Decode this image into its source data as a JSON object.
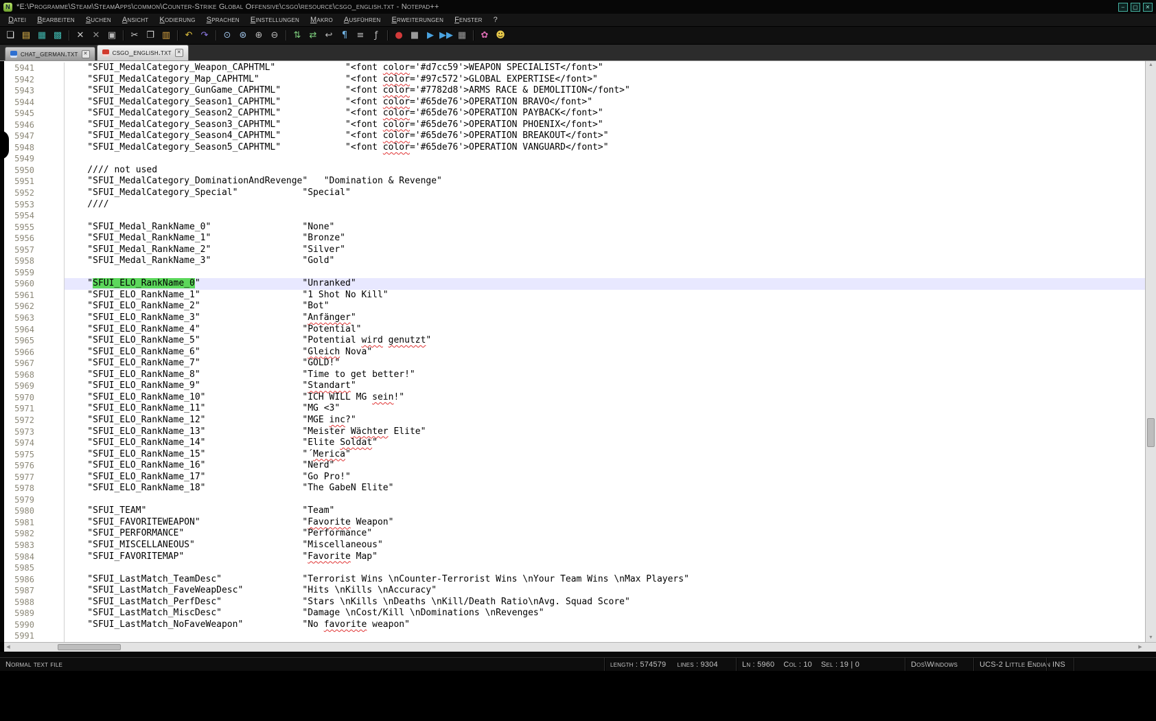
{
  "window": {
    "title": "*E:\\Programme\\Steam\\SteamApps\\common\\Counter-Strike Global Offensive\\csgo\\resource\\csgo_english.txt - Notepad++",
    "app_icon_label": "N",
    "controls": [
      {
        "name": "minimize-button",
        "glyph": "–"
      },
      {
        "name": "maximize-button",
        "glyph": "▢"
      },
      {
        "name": "close-button",
        "glyph": "✕"
      }
    ]
  },
  "menu": {
    "items": [
      {
        "name": "menu-datei",
        "label": "Datei"
      },
      {
        "name": "menu-bearbeiten",
        "label": "Bearbeiten"
      },
      {
        "name": "menu-suchen",
        "label": "Suchen"
      },
      {
        "name": "menu-ansicht",
        "label": "Ansicht"
      },
      {
        "name": "menu-kodierung",
        "label": "Kodierung"
      },
      {
        "name": "menu-sprachen",
        "label": "Sprachen"
      },
      {
        "name": "menu-einstellungen",
        "label": "Einstellungen"
      },
      {
        "name": "menu-makro",
        "label": "Makro"
      },
      {
        "name": "menu-ausfuehren",
        "label": "Ausführen"
      },
      {
        "name": "menu-erweiterungen",
        "label": "Erweiterungen"
      },
      {
        "name": "menu-fenster",
        "label": "Fenster"
      },
      {
        "name": "menu-help",
        "label": "?"
      }
    ]
  },
  "toolbar": {
    "icons": [
      {
        "name": "new-file-icon",
        "glyph": "❏",
        "color": "#e8e8e8"
      },
      {
        "name": "open-file-icon",
        "glyph": "▤",
        "color": "#e3b84d"
      },
      {
        "name": "save-icon",
        "glyph": "▦",
        "color": "#3fb6ad"
      },
      {
        "name": "save-all-icon",
        "glyph": "▩",
        "color": "#3fb6ad"
      },
      {
        "separator": true
      },
      {
        "name": "close-file-icon",
        "glyph": "✕",
        "color": "#c9c9c9"
      },
      {
        "name": "close-all-icon",
        "glyph": "✕",
        "color": "#8f8f8f"
      },
      {
        "name": "print-icon",
        "glyph": "▣",
        "color": "#b9b9b9"
      },
      {
        "separator": true
      },
      {
        "name": "cut-icon",
        "glyph": "✂",
        "color": "#cfcfcf"
      },
      {
        "name": "copy-icon",
        "glyph": "❐",
        "color": "#cfcfcf"
      },
      {
        "name": "paste-icon",
        "glyph": "▥",
        "color": "#d9a441"
      },
      {
        "separator": true
      },
      {
        "name": "undo-icon",
        "glyph": "↶",
        "color": "#e0c23e"
      },
      {
        "name": "redo-icon",
        "glyph": "↷",
        "color": "#8f7be8"
      },
      {
        "separator": true
      },
      {
        "name": "find-icon",
        "glyph": "⊙",
        "color": "#9fc3e8"
      },
      {
        "name": "replace-icon",
        "glyph": "⊛",
        "color": "#9fc3e8"
      },
      {
        "name": "zoom-in-icon",
        "glyph": "⊕",
        "color": "#bcbcbc"
      },
      {
        "name": "zoom-out-icon",
        "glyph": "⊖",
        "color": "#bcbcbc"
      },
      {
        "separator": true
      },
      {
        "name": "sync-vertical-scroll-icon",
        "glyph": "⇅",
        "color": "#7fd17f"
      },
      {
        "name": "sync-horizontal-scroll-icon",
        "glyph": "⇄",
        "color": "#7fd17f"
      },
      {
        "name": "word-wrap-icon",
        "glyph": "↩",
        "color": "#bcbcbc"
      },
      {
        "name": "show-all-characters-icon",
        "glyph": "¶",
        "color": "#74b6e8"
      },
      {
        "name": "indent-guide-icon",
        "glyph": "≡",
        "color": "#bcbcbc"
      },
      {
        "name": "function-list-icon",
        "glyph": "ƒ",
        "color": "#bcbcbc"
      },
      {
        "separator": true
      },
      {
        "name": "record-macro-icon",
        "glyph": "●",
        "color": "#d23a3a"
      },
      {
        "name": "stop-macro-icon",
        "glyph": "■",
        "color": "#9a9a9a"
      },
      {
        "name": "play-macro-icon",
        "glyph": "▶",
        "color": "#4aa3e0"
      },
      {
        "name": "run-macro-multiple-icon",
        "glyph": "▶▶",
        "color": "#4aa3e0"
      },
      {
        "name": "save-macro-icon",
        "glyph": "▦",
        "color": "#9a9a9a"
      },
      {
        "separator": true
      },
      {
        "name": "plugin-icon-1",
        "glyph": "✿",
        "color": "#d86ab0"
      },
      {
        "name": "plugin-icon-2",
        "glyph": "☻",
        "color": "#e8c94a"
      }
    ]
  },
  "tabs": [
    {
      "label": "chat_german.txt",
      "state": "saved",
      "active": false
    },
    {
      "label": "csgo_english.txt",
      "state": "modified",
      "active": true
    }
  ],
  "editor": {
    "colors": {
      "current_line_bg": "#e8e8ff",
      "selection_bg": "#5bd75b",
      "misspell_underline": "#e03131"
    },
    "lines": [
      {
        "n": 5941,
        "k": "\"SFUI_MedalCategory_Weapon_CAPHTML\"",
        "v": "\"<font color='#d7cc59'>WEAPON SPECIALIST</font>\"",
        "c": 52,
        "mis": [
          "color"
        ]
      },
      {
        "n": 5942,
        "k": "\"SFUI_MedalCategory_Map_CAPHTML\"",
        "v": "\"<font color='#97c572'>GLOBAL EXPERTISE</font>\"",
        "c": 52,
        "mis": [
          "color"
        ]
      },
      {
        "n": 5943,
        "k": "\"SFUI_MedalCategory_GunGame_CAPHTML\"",
        "v": "\"<font color='#7782d8'>ARMS RACE & DEMOLITION</font>\"",
        "c": 52,
        "mis": [
          "color"
        ]
      },
      {
        "n": 5944,
        "k": "\"SFUI_MedalCategory_Season1_CAPHTML\"",
        "v": "\"<font color='#65de76'>OPERATION BRAVO</font>\"",
        "c": 52,
        "mis": [
          "color"
        ]
      },
      {
        "n": 5945,
        "k": "\"SFUI_MedalCategory_Season2_CAPHTML\"",
        "v": "\"<font color='#65de76'>OPERATION PAYBACK</font>\"",
        "c": 52,
        "mis": [
          "color"
        ]
      },
      {
        "n": 5946,
        "k": "\"SFUI_MedalCategory_Season3_CAPHTML\"",
        "v": "\"<font color='#65de76'>OPERATION PHOENIX</font>\"",
        "c": 52,
        "mis": [
          "color"
        ]
      },
      {
        "n": 5947,
        "k": "\"SFUI_MedalCategory_Season4_CAPHTML\"",
        "v": "\"<font color='#65de76'>OPERATION BREAKOUT</font>\"",
        "c": 52,
        "mis": [
          "color"
        ]
      },
      {
        "n": 5948,
        "k": "\"SFUI_MedalCategory_Season5_CAPHTML\"",
        "v": "\"<font color='#65de76'>OPERATION VANGUARD</font>\"",
        "c": 52,
        "mis": [
          "color"
        ]
      },
      {
        "n": 5949
      },
      {
        "n": 5950,
        "k": "//// not used"
      },
      {
        "n": 5951,
        "k": "\"SFUI_MedalCategory_DominationAndRevenge\"",
        "v": "\"Domination & Revenge\"",
        "c": 48
      },
      {
        "n": 5952,
        "k": "\"SFUI_MedalCategory_Special\"",
        "v": "\"Special\"",
        "c": 44
      },
      {
        "n": 5953,
        "k": "////"
      },
      {
        "n": 5954
      },
      {
        "n": 5955,
        "k": "\"SFUI_Medal_RankName_0\"",
        "v": "\"None\"",
        "c": 44
      },
      {
        "n": 5956,
        "k": "\"SFUI_Medal_RankName_1\"",
        "v": "\"Bronze\"",
        "c": 44
      },
      {
        "n": 5957,
        "k": "\"SFUI_Medal_RankName_2\"",
        "v": "\"Silver\"",
        "c": 44
      },
      {
        "n": 5958,
        "k": "\"SFUI_Medal_RankName_3\"",
        "v": "\"Gold\"",
        "c": 44
      },
      {
        "n": 5959
      },
      {
        "n": 5960,
        "k": "\"SFUI_ELO_RankName_0\"",
        "v": "\"Unranked\"",
        "c": 44,
        "cur": true,
        "sel": "SFUI_ELO_RankName_0"
      },
      {
        "n": 5961,
        "k": "\"SFUI_ELO_RankName_1\"",
        "v": "\"1 Shot No Kill\"",
        "c": 44
      },
      {
        "n": 5962,
        "k": "\"SFUI_ELO_RankName_2\"",
        "v": "\"Bot\"",
        "c": 44
      },
      {
        "n": 5963,
        "k": "\"SFUI_ELO_RankName_3\"",
        "v": "\"Anfänger\"",
        "c": 44,
        "mis": [
          "Anfänger"
        ]
      },
      {
        "n": 5964,
        "k": "\"SFUI_ELO_RankName_4\"",
        "v": "\"Potential\"",
        "c": 44
      },
      {
        "n": 5965,
        "k": "\"SFUI_ELO_RankName_5\"",
        "v": "\"Potential wird genutzt\"",
        "c": 44,
        "mis": [
          "wird",
          "genutzt"
        ]
      },
      {
        "n": 5966,
        "k": "\"SFUI_ELO_RankName_6\"",
        "v": "\"Gleich Nova\"",
        "c": 44,
        "mis": [
          "Gleich"
        ]
      },
      {
        "n": 5967,
        "k": "\"SFUI_ELO_RankName_7\"",
        "v": "\"GOLD!\"",
        "c": 44
      },
      {
        "n": 5968,
        "k": "\"SFUI_ELO_RankName_8\"",
        "v": "\"Time to get better!\"",
        "c": 44
      },
      {
        "n": 5969,
        "k": "\"SFUI_ELO_RankName_9\"",
        "v": "\"Standart\"",
        "c": 44,
        "mis": [
          "Standart"
        ]
      },
      {
        "n": 5970,
        "k": "\"SFUI_ELO_RankName_10\"",
        "v": "\"ICH WILL MG sein!\"",
        "c": 44,
        "mis": [
          "sein"
        ]
      },
      {
        "n": 5971,
        "k": "\"SFUI_ELO_RankName_11\"",
        "v": "\"MG <3\"",
        "c": 44
      },
      {
        "n": 5972,
        "k": "\"SFUI_ELO_RankName_12\"",
        "v": "\"MGE inc?\"",
        "c": 44,
        "mis": [
          "inc"
        ]
      },
      {
        "n": 5973,
        "k": "\"SFUI_ELO_RankName_13\"",
        "v": "\"Meister Wächter Elite\"",
        "c": 44,
        "mis": [
          "Wächter"
        ]
      },
      {
        "n": 5974,
        "k": "\"SFUI_ELO_RankName_14\"",
        "v": "\"Elite Soldat\"",
        "c": 44,
        "mis": [
          "Soldat"
        ]
      },
      {
        "n": 5975,
        "k": "\"SFUI_ELO_RankName_15\"",
        "v": "\"´Merica\"",
        "c": 44,
        "mis": [
          "Merica"
        ]
      },
      {
        "n": 5976,
        "k": "\"SFUI_ELO_RankName_16\"",
        "v": "\"Nerd\"",
        "c": 44
      },
      {
        "n": 5977,
        "k": "\"SFUI_ELO_RankName_17\"",
        "v": "\"Go Pro!\"",
        "c": 44
      },
      {
        "n": 5978,
        "k": "\"SFUI_ELO_RankName_18\"",
        "v": "\"The GabeN Elite\"",
        "c": 44
      },
      {
        "n": 5979
      },
      {
        "n": 5980,
        "k": "\"SFUI_TEAM\"",
        "v": "\"Team\"",
        "c": 44
      },
      {
        "n": 5981,
        "k": "\"SFUI_FAVORITEWEAPON\"",
        "v": "\"Favorite Weapon\"",
        "c": 44,
        "mis": [
          "Favorite"
        ]
      },
      {
        "n": 5982,
        "k": "\"SFUI_PERFORMANCE\"",
        "v": "\"Performance\"",
        "c": 44
      },
      {
        "n": 5983,
        "k": "\"SFUI_MISCELLANEOUS\"",
        "v": "\"Miscellaneous\"",
        "c": 44
      },
      {
        "n": 5984,
        "k": "\"SFUI_FAVORITEMAP\"",
        "v": "\"Favorite Map\"",
        "c": 44,
        "mis": [
          "Favorite"
        ]
      },
      {
        "n": 5985
      },
      {
        "n": 5986,
        "k": "\"SFUI_LastMatch_TeamDesc\"",
        "v": "\"Terrorist Wins \\nCounter-Terrorist Wins \\nYour Team Wins \\nMax Players\"",
        "c": 44
      },
      {
        "n": 5987,
        "k": "\"SFUI_LastMatch_FaveWeapDesc\"",
        "v": "\"Hits \\nKills \\nAccuracy\"",
        "c": 44
      },
      {
        "n": 5988,
        "k": "\"SFUI_LastMatch_PerfDesc\"",
        "v": "\"Stars \\nKills \\nDeaths \\nKill/Death Ratio\\nAvg. Squad Score\"",
        "c": 44
      },
      {
        "n": 5989,
        "k": "\"SFUI_LastMatch_MiscDesc\"",
        "v": "\"Damage \\nCost/Kill \\nDominations \\nRevenges\"",
        "c": 44
      },
      {
        "n": 5990,
        "k": "\"SFUI_LastMatch_NoFaveWeapon\"",
        "v": "\"No favorite weapon\"",
        "c": 44,
        "mis": [
          "favorite"
        ]
      },
      {
        "n": 5991
      }
    ]
  },
  "status_bar": {
    "segments": [
      {
        "name": "status-doc-type",
        "text": "Normal text file"
      },
      {
        "name": "status-length-lines",
        "text": "length : 574579     lines : 9304"
      },
      {
        "name": "status-cursor-position",
        "text": "Ln : 5960    Col : 10    Sel : 19 | 0"
      },
      {
        "name": "status-eol-format",
        "text": "Dos\\Windows"
      },
      {
        "name": "status-encoding",
        "text": "UCS-2 Little Endian"
      },
      {
        "name": "status-insert-mode",
        "text": "INS"
      }
    ]
  }
}
